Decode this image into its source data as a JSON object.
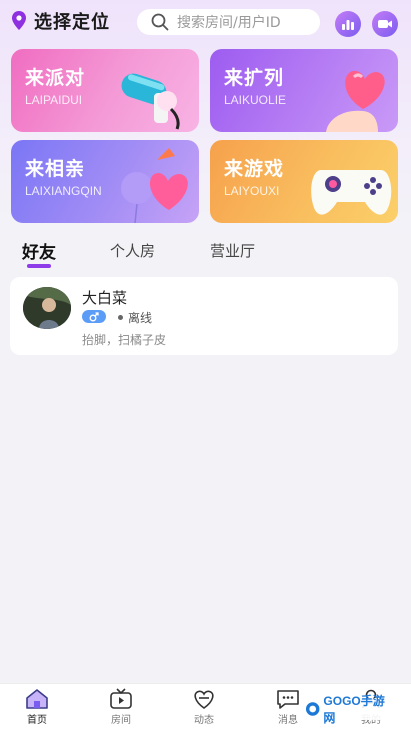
{
  "header": {
    "location_label": "选择定位",
    "search_placeholder": "搜索房间/用户ID"
  },
  "cards": [
    {
      "title": "来派对",
      "subtitle": "LAIPAIDUI"
    },
    {
      "title": "来扩列",
      "subtitle": "LAIKUOLIE"
    },
    {
      "title": "来相亲",
      "subtitle": "LAIXIANGQIN"
    },
    {
      "title": "来游戏",
      "subtitle": "LAIYOUXI"
    }
  ],
  "tabs": [
    {
      "label": "好友",
      "active": true
    },
    {
      "label": "个人房",
      "active": false
    },
    {
      "label": "营业厅",
      "active": false
    }
  ],
  "friends": [
    {
      "name": "大白菜",
      "gender_icon": "male-icon",
      "status": "离线",
      "signature": "抬脚，扫橘子皮"
    }
  ],
  "bottom_nav": [
    {
      "label": "首页",
      "icon": "home-icon",
      "active": true
    },
    {
      "label": "房间",
      "icon": "tv-icon",
      "active": false
    },
    {
      "label": "动态",
      "icon": "heart-chat-icon",
      "active": false
    },
    {
      "label": "消息",
      "icon": "message-icon",
      "active": false
    },
    {
      "label": "我的",
      "icon": "profile-icon",
      "active": false
    }
  ],
  "watermark": {
    "text": "GOGO手游网"
  },
  "colors": {
    "accent": "#8e3bea",
    "header_button": "#9a6cf3",
    "gender_male": "#5b9df6"
  }
}
